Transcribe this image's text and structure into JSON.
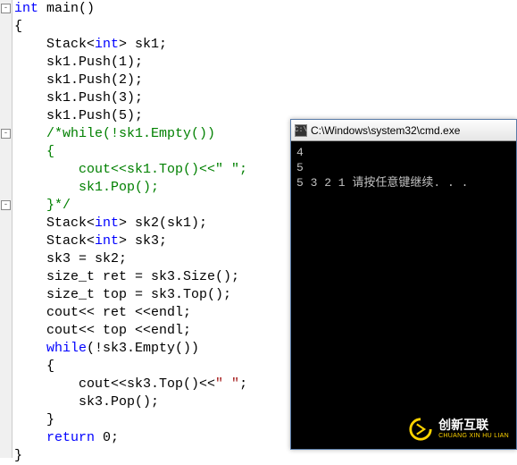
{
  "code": {
    "lines": [
      {
        "indent": 0,
        "segs": [
          {
            "cls": "kw",
            "t": "int"
          },
          {
            "cls": "plain",
            "t": " main()"
          }
        ]
      },
      {
        "indent": 0,
        "segs": [
          {
            "cls": "plain",
            "t": "{"
          }
        ]
      },
      {
        "indent": 2,
        "segs": [
          {
            "cls": "plain",
            "t": "Stack<"
          },
          {
            "cls": "type",
            "t": "int"
          },
          {
            "cls": "plain",
            "t": "> sk1;"
          }
        ]
      },
      {
        "indent": 2,
        "segs": [
          {
            "cls": "plain",
            "t": "sk1.Push(1);"
          }
        ]
      },
      {
        "indent": 2,
        "segs": [
          {
            "cls": "plain",
            "t": "sk1.Push(2);"
          }
        ]
      },
      {
        "indent": 2,
        "segs": [
          {
            "cls": "plain",
            "t": "sk1.Push(3);"
          }
        ]
      },
      {
        "indent": 2,
        "segs": [
          {
            "cls": "plain",
            "t": "sk1.Push(5);"
          }
        ]
      },
      {
        "indent": 2,
        "segs": [
          {
            "cls": "comment",
            "t": "/*while(!sk1.Empty())"
          }
        ]
      },
      {
        "indent": 2,
        "segs": [
          {
            "cls": "comment",
            "t": "{"
          }
        ]
      },
      {
        "indent": 4,
        "segs": [
          {
            "cls": "comment",
            "t": "cout<<sk1.Top()<<\" \";"
          }
        ]
      },
      {
        "indent": 4,
        "segs": [
          {
            "cls": "comment",
            "t": "sk1.Pop();"
          }
        ]
      },
      {
        "indent": 2,
        "segs": [
          {
            "cls": "comment",
            "t": "}*/"
          }
        ]
      },
      {
        "indent": 2,
        "segs": [
          {
            "cls": "plain",
            "t": "Stack<"
          },
          {
            "cls": "type",
            "t": "int"
          },
          {
            "cls": "plain",
            "t": "> sk2(sk1);"
          }
        ]
      },
      {
        "indent": 2,
        "segs": [
          {
            "cls": "plain",
            "t": "Stack<"
          },
          {
            "cls": "type",
            "t": "int"
          },
          {
            "cls": "plain",
            "t": "> sk3;"
          }
        ]
      },
      {
        "indent": 2,
        "segs": [
          {
            "cls": "plain",
            "t": "sk3 = sk2;"
          }
        ]
      },
      {
        "indent": 2,
        "segs": [
          {
            "cls": "plain",
            "t": "size_t ret = sk3.Size();"
          }
        ]
      },
      {
        "indent": 2,
        "segs": [
          {
            "cls": "plain",
            "t": "size_t top = sk3.Top();"
          }
        ]
      },
      {
        "indent": 2,
        "segs": [
          {
            "cls": "plain",
            "t": "cout<< ret <<endl;"
          }
        ]
      },
      {
        "indent": 2,
        "segs": [
          {
            "cls": "plain",
            "t": "cout<< top <<endl;"
          }
        ]
      },
      {
        "indent": 2,
        "segs": [
          {
            "cls": "kw",
            "t": "while"
          },
          {
            "cls": "plain",
            "t": "(!sk3.Empty())"
          }
        ]
      },
      {
        "indent": 2,
        "segs": [
          {
            "cls": "plain",
            "t": "{"
          }
        ]
      },
      {
        "indent": 4,
        "segs": [
          {
            "cls": "plain",
            "t": "cout<<sk3.Top()<<"
          },
          {
            "cls": "string",
            "t": "\" \""
          },
          {
            "cls": "plain",
            "t": ";"
          }
        ]
      },
      {
        "indent": 4,
        "segs": [
          {
            "cls": "plain",
            "t": "sk3.Pop();"
          }
        ]
      },
      {
        "indent": 2,
        "segs": [
          {
            "cls": "plain",
            "t": "}"
          }
        ]
      },
      {
        "indent": 2,
        "segs": [
          {
            "cls": "kw",
            "t": "return"
          },
          {
            "cls": "plain",
            "t": " 0;"
          }
        ]
      },
      {
        "indent": 0,
        "segs": [
          {
            "cls": "plain",
            "t": "}"
          }
        ]
      }
    ],
    "folds": [
      {
        "row": 0,
        "glyph": "-"
      },
      {
        "row": 7,
        "glyph": "-"
      },
      {
        "row": 11,
        "glyph": "-"
      }
    ]
  },
  "console": {
    "title": "C:\\Windows\\system32\\cmd.exe",
    "icon_glyph": "C:\\",
    "output_lines": [
      "4",
      "5",
      "5 3 2 1 请按任意键继续. . ."
    ]
  },
  "watermark": {
    "zh": "创新互联",
    "en": "CHUANG XIN HU LIAN"
  }
}
